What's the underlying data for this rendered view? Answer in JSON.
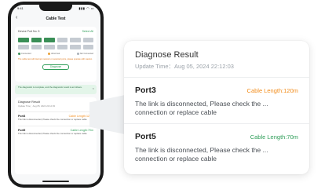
{
  "phone": {
    "status_time": "9:41",
    "signal": "▮▮▮ ◠ ▭",
    "title": "Cable Test",
    "back_icon": "chevron-left-icon",
    "port_card": {
      "heading": "Device Port No. 5",
      "select_all": "Select All",
      "ports": [
        "ok",
        "ok",
        "ok",
        "off",
        "off",
        "off",
        "off",
        "off",
        "off",
        "off",
        "off",
        "off"
      ],
      "legend": [
        "Connected",
        "Abnormal",
        "Not Connected"
      ],
      "note": "The cable test will interrupt network on selected ports, please operate with caution.",
      "diagnose_button": "Diagnose"
    },
    "banner": "The diagnostic is complete, and the diagnostic result is as follows.",
    "close_icon": "×",
    "result": {
      "title": "Diagnose Result",
      "time": "Update Time：Aug 05, 2024 22:12:03",
      "entries": [
        {
          "port": "Port3",
          "length": "Cable Length:120m",
          "message": "The link is disconnected, Please check the connection or replace cable"
        },
        {
          "port": "Port5",
          "length": "Cable Length:70m",
          "message": "The link is disconnected, Please check the connection or replace cable"
        }
      ]
    }
  },
  "zoom": {
    "title": "Diagnose Result",
    "time": "Update Time：Aug 05, 2024 22:12:03",
    "entries": [
      {
        "port": "Port3",
        "length": "Cable Length:120m",
        "length_color": "#f28c1b",
        "message": "The link is disconnected, Please check the ... connection or replace cable"
      },
      {
        "port": "Port5",
        "length": "Cable Length:70m",
        "length_color": "#2f9e59",
        "message": "The link is disconnected, Please check the ... connection or replace cable"
      }
    ]
  },
  "colors": {
    "accent_green": "#2f9e59",
    "accent_orange": "#f28c1b"
  }
}
